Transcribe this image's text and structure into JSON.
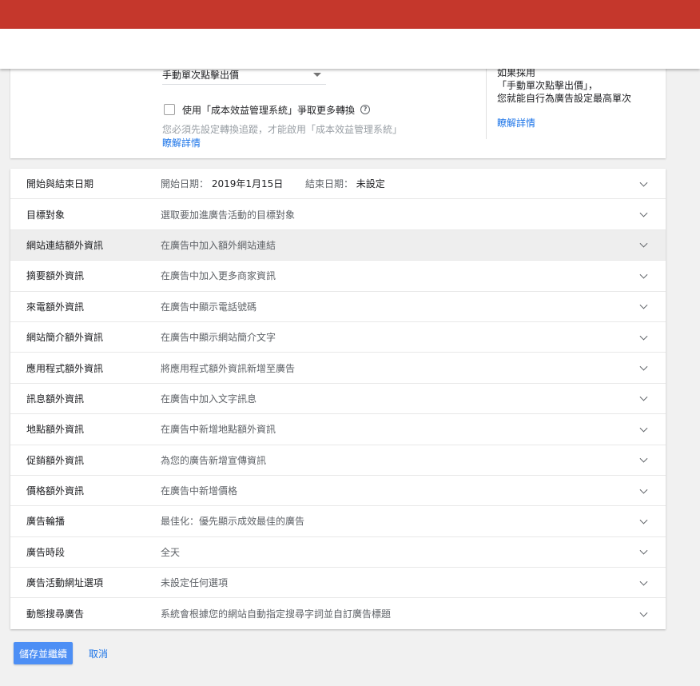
{
  "bidding": {
    "strategy_value": "手動單次點擊出價",
    "checkbox_label": "使用「成本效益管理系統」爭取更多轉換",
    "hint": "您必須先設定轉換追蹤，才能啟用「成本效益管理系統」",
    "learn_more": "瞭解詳情",
    "side_note_lines": [
      "如果採用",
      "「手動單次點擊出價」，",
      "您就能自行為廣告設定最高單次"
    ],
    "side_learn_more": "瞭解詳情"
  },
  "settings_rows": [
    {
      "label": "開始與結束日期",
      "start_label": "開始日期：",
      "start_value": "2019年1月15日",
      "end_label": "結束日期：",
      "end_value": "未設定"
    },
    {
      "label": "目標對象",
      "value": "選取要加進廣告活動的目標對象"
    },
    {
      "label": "網站連結額外資訊",
      "value": "在廣告中加入額外網站連結"
    },
    {
      "label": "摘要額外資訊",
      "value": "在廣告中加入更多商家資訊"
    },
    {
      "label": "來電額外資訊",
      "value": "在廣告中顯示電話號碼"
    },
    {
      "label": "網站簡介額外資訊",
      "value": "在廣告中顯示網站簡介文字"
    },
    {
      "label": "應用程式額外資訊",
      "value": "將應用程式額外資訊新增至廣告"
    },
    {
      "label": "訊息額外資訊",
      "value": "在廣告中加入文字訊息"
    },
    {
      "label": "地點額外資訊",
      "value": "在廣告中新增地點額外資訊"
    },
    {
      "label": "促銷額外資訊",
      "value": "為您的廣告新增宣傳資訊"
    },
    {
      "label": "價格額外資訊",
      "value": "在廣告中新增價格"
    },
    {
      "label": "廣告輪播",
      "value": "最佳化：優先顯示成效最佳的廣告"
    },
    {
      "label": "廣告時段",
      "value": "全天"
    },
    {
      "label": "廣告活動網址選項",
      "value": "未設定任何選項"
    },
    {
      "label": "動態搜尋廣告",
      "value": "系統會根據您的網站自動指定搜尋字詞並自訂廣告標題"
    }
  ],
  "actions": {
    "save_label": "儲存並繼續",
    "cancel_label": "取消"
  },
  "colors": {
    "header_red": "#c5372c",
    "primary_button": "#4d8ff5",
    "link": "#1a73e8"
  },
  "icons": {
    "dropdown": "dropdown-arrow-icon",
    "help": "help-circle-icon",
    "expand": "chevron-down-icon"
  }
}
